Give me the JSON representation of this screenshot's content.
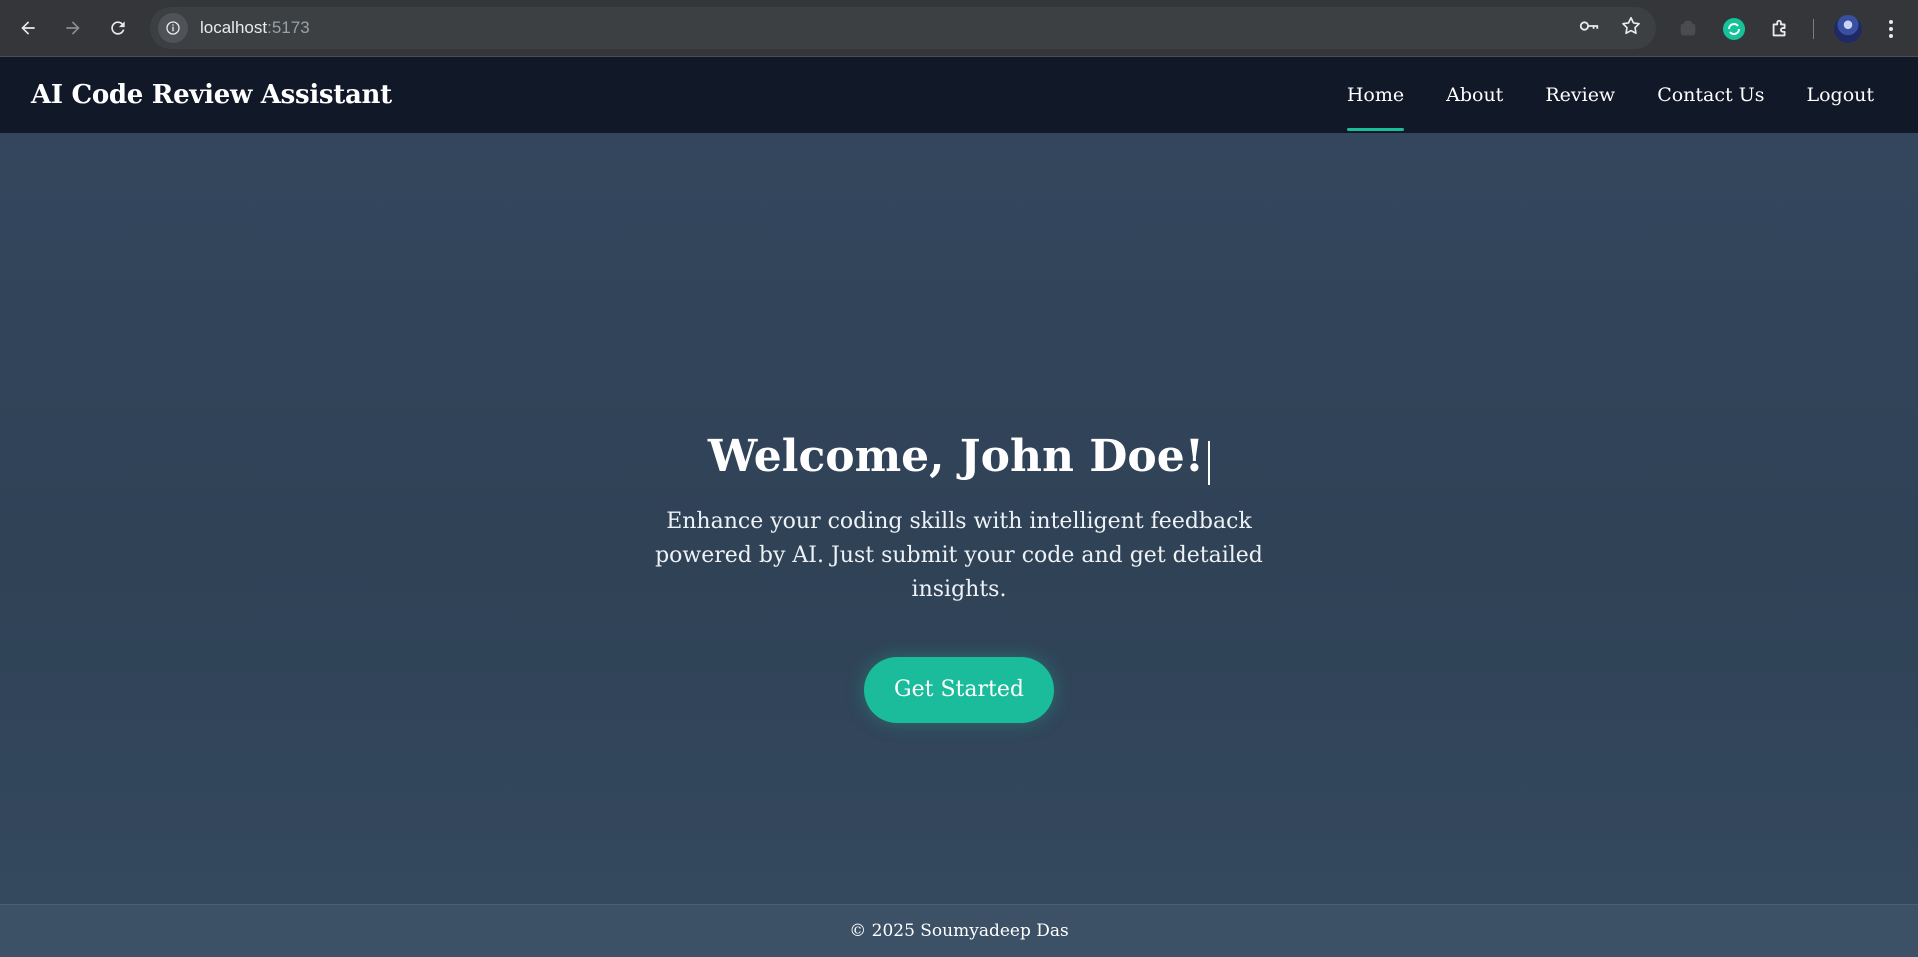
{
  "browser": {
    "url_host": "localhost",
    "url_port": ":5173",
    "icons": [
      "back-arrow-icon",
      "forward-arrow-icon",
      "reload-icon",
      "site-info-icon",
      "password-key-icon",
      "bookmark-star-icon",
      "extension-icon",
      "grammarly-icon",
      "puzzle-extensions-icon",
      "profile-avatar",
      "more-menu-icon"
    ]
  },
  "nav": {
    "brand": "AI Code Review Assistant",
    "links": [
      "Home",
      "About",
      "Review",
      "Contact Us",
      "Logout"
    ],
    "active": "Home"
  },
  "hero": {
    "title": "Welcome, John Doe!",
    "subtitle": "Enhance your coding skills with intelligent feedback powered by AI. Just submit your code and get detailed insights.",
    "cta": "Get Started"
  },
  "footer": {
    "text": "© 2025 Soumyadeep Das"
  },
  "colors": {
    "navbar": "#111827",
    "accent": "#1abc9c",
    "hero_bg": "#2f4256",
    "footer_bg": "#3d5166"
  }
}
